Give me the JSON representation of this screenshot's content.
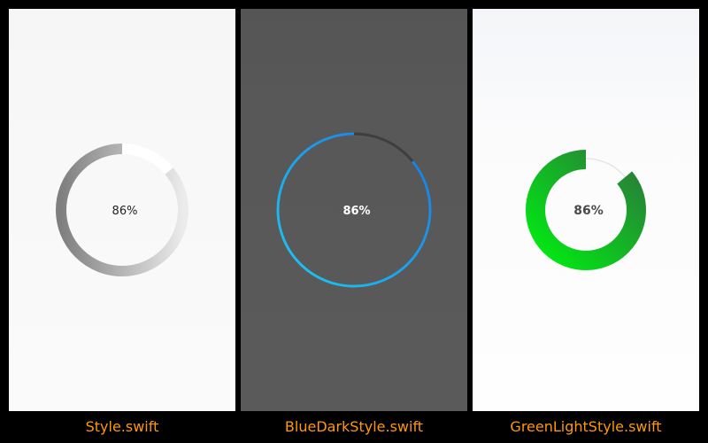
{
  "panels": [
    {
      "id": "style",
      "progress_label": "86%",
      "progress_fraction": 0.86,
      "caption": "Style.swift",
      "colors": {
        "background": "#f8f8f8",
        "track": "#ffffff",
        "progress_start": "#ebebeb",
        "progress_end": "#7f7f7f",
        "text": "#222222"
      }
    },
    {
      "id": "blue-dark",
      "progress_label": "86%",
      "progress_fraction": 0.86,
      "caption": "BlueDarkStyle.swift",
      "colors": {
        "background": "#585858",
        "track": "#3e3e3e",
        "progress_start": "#1a78e0",
        "progress_end": "#22c8f0",
        "text": "#ffffff"
      }
    },
    {
      "id": "green-light",
      "progress_label": "86%",
      "progress_fraction": 0.86,
      "caption": "GreenLightStyle.swift",
      "colors": {
        "background": "#fbfbfc",
        "track": "#e6e6e6",
        "progress_start": "#2a7a3a",
        "progress_end": "#00ee11",
        "text": "#4a4a4a"
      }
    }
  ],
  "caption_color": "#ff9900",
  "page_background": "#000000"
}
